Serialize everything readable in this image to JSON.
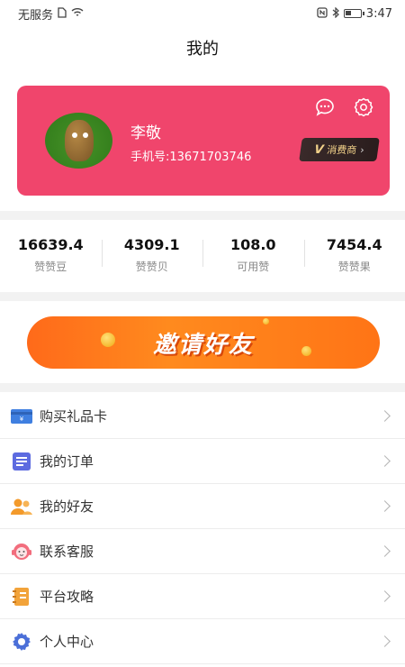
{
  "status_bar": {
    "carrier": "无服务",
    "time": "3:47",
    "battery_level": 0.4,
    "icons": [
      "sim-icon",
      "wifi-icon",
      "nfc-icon",
      "bluetooth-icon",
      "battery-icon"
    ]
  },
  "header": {
    "title": "我的"
  },
  "profile": {
    "name": "李敬",
    "phone": "手机号:13671703746",
    "badge_prefix": "V",
    "badge_label": "消费商",
    "card_color": "#f0456c",
    "icons": [
      "message-icon",
      "settings-icon"
    ]
  },
  "stats": [
    {
      "value": "16639.4",
      "label": "赞赞豆"
    },
    {
      "value": "4309.1",
      "label": "赞赞贝"
    },
    {
      "value": "108.0",
      "label": "可用赞"
    },
    {
      "value": "7454.4",
      "label": "赞赞果"
    }
  ],
  "banner": {
    "text": "邀请好友",
    "color": "#ff7416"
  },
  "menu": [
    {
      "label": "购买礼品卡",
      "icon": "gift-card-icon"
    },
    {
      "label": "我的订单",
      "icon": "order-icon"
    },
    {
      "label": "我的好友",
      "icon": "friends-icon"
    },
    {
      "label": "联系客服",
      "icon": "customer-service-icon"
    },
    {
      "label": "平台攻略",
      "icon": "guide-icon"
    },
    {
      "label": "个人中心",
      "icon": "personal-center-icon"
    }
  ]
}
